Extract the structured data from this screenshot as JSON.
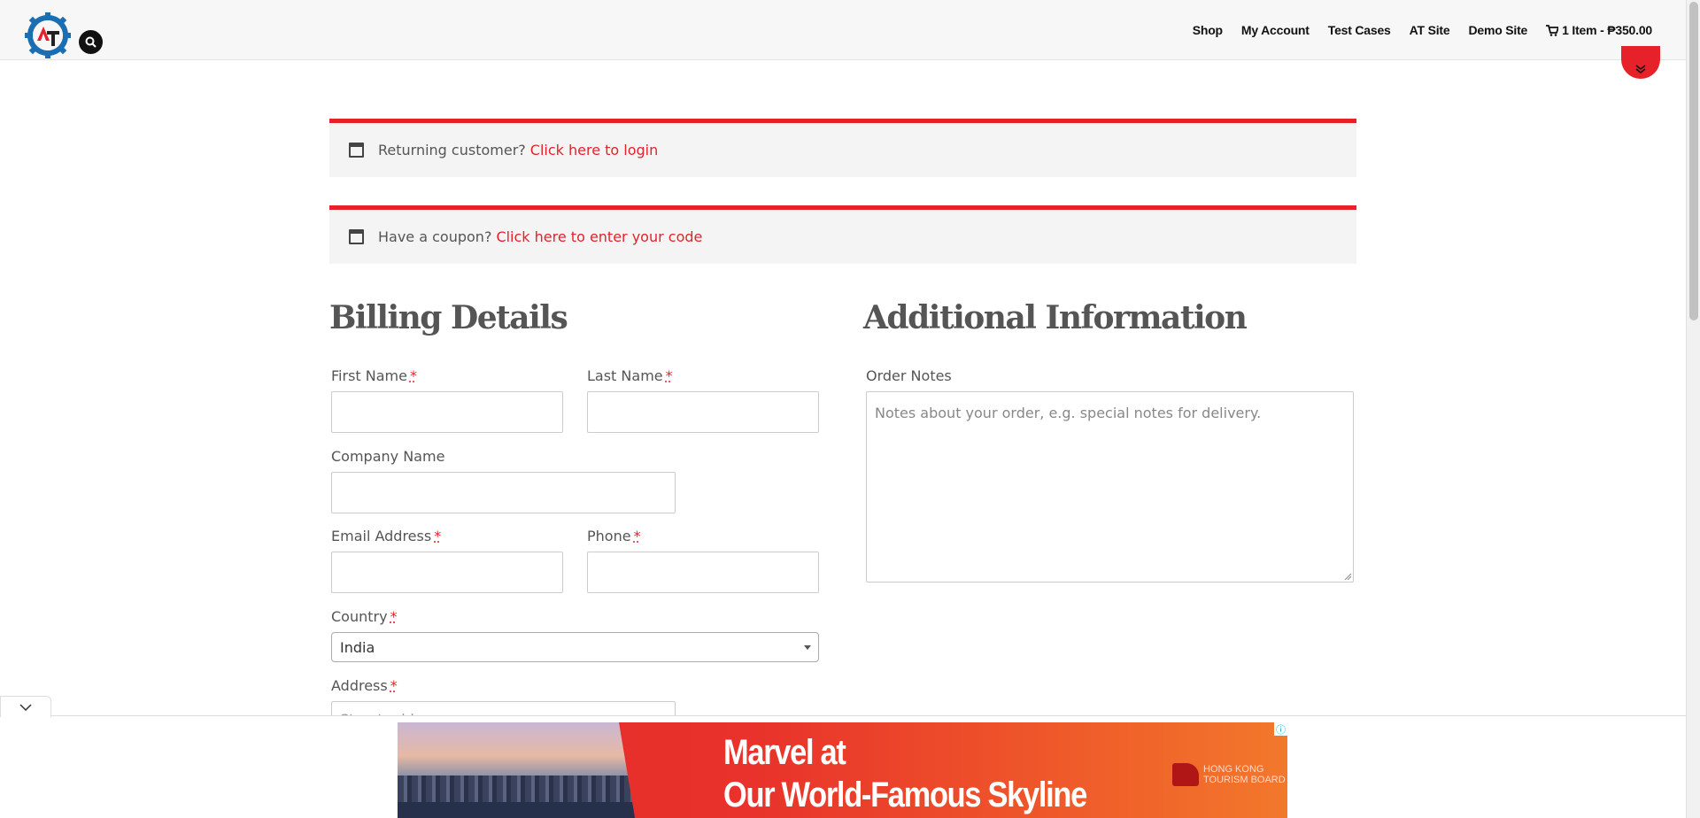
{
  "header": {
    "nav": [
      {
        "label": "Shop"
      },
      {
        "label": "My Account"
      },
      {
        "label": "Test Cases"
      },
      {
        "label": "AT Site"
      },
      {
        "label": "Demo Site"
      }
    ],
    "cart_label": "1 Item - ₱350.00"
  },
  "notices": {
    "login_text": "Returning customer?",
    "login_link": "Click here to login",
    "coupon_text": "Have a coupon?",
    "coupon_link": "Click here to enter your code"
  },
  "billing": {
    "title": "Billing Details",
    "first_name_label": "First Name",
    "last_name_label": "Last Name",
    "company_label": "Company Name",
    "email_label": "Email Address",
    "phone_label": "Phone",
    "country_label": "Country",
    "country_value": "India",
    "address_label": "Address",
    "address_placeholder": "Street address",
    "required_mark": "*"
  },
  "additional": {
    "title": "Additional Information",
    "order_notes_label": "Order Notes",
    "order_notes_placeholder": "Notes about your order, e.g. special notes for delivery."
  },
  "ad": {
    "headline_line1": "Marvel at",
    "headline_line2": "Our World-Famous Skyline",
    "brand_line1": "HONG KONG",
    "brand_line2": "TOURISM BOARD",
    "info_icon": "ⓘ"
  },
  "colors": {
    "accent": "#e62129",
    "header_bg": "#f7f7f7",
    "notice_bg": "#f4f4f4"
  }
}
